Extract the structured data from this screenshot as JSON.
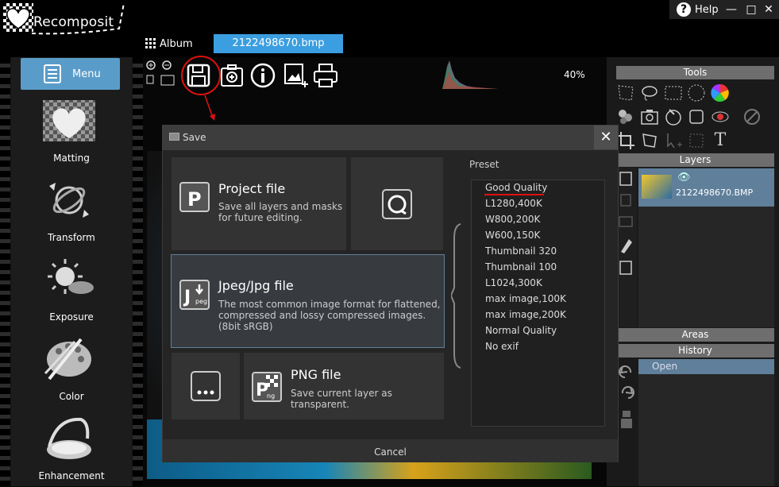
{
  "app": {
    "name": "Recomposit"
  },
  "titlebar": {
    "help_label": "Help",
    "min": "—",
    "max": "□",
    "close": "✕"
  },
  "tabs": {
    "album": "Album",
    "file": "2122498670.bmp"
  },
  "sidebar": {
    "menu_label": "Menu",
    "items": [
      {
        "label": "Matting"
      },
      {
        "label": "Transform"
      },
      {
        "label": "Exposure"
      },
      {
        "label": "Color"
      },
      {
        "label": "Enhancement"
      }
    ]
  },
  "workspace": {
    "zoom": "40%"
  },
  "right_panel": {
    "tools_header": "Tools",
    "layers_header": "Layers",
    "layer_name": "2122498670.BMP",
    "areas_header": "Areas",
    "history_header": "History",
    "history_item": "Open"
  },
  "dialog": {
    "title": "Save",
    "options": {
      "project": {
        "title": "Project file",
        "desc": "Save all layers and masks for future editing."
      },
      "jpeg": {
        "title": "Jpeg/Jpg file",
        "desc": "The most common image format for flattened, compressed and lossy compressed images. (8bit sRGB)"
      },
      "png": {
        "title": "PNG file",
        "desc": "Save current layer as transparent."
      }
    },
    "preset_label": "Preset",
    "presets": [
      "Good Quality",
      "L1280,400K",
      "W800,200K",
      "W600,150K",
      "Thumbnail 320",
      "Thumbnail 100",
      "L1024,300K",
      "max image,100K",
      "max image,200K",
      "Normal Quality",
      "No exif"
    ],
    "cancel_label": "Cancel"
  },
  "colors": {
    "accent": "#3b9ee0",
    "selection": "#5f7f9a",
    "annotation": "#e01010"
  }
}
